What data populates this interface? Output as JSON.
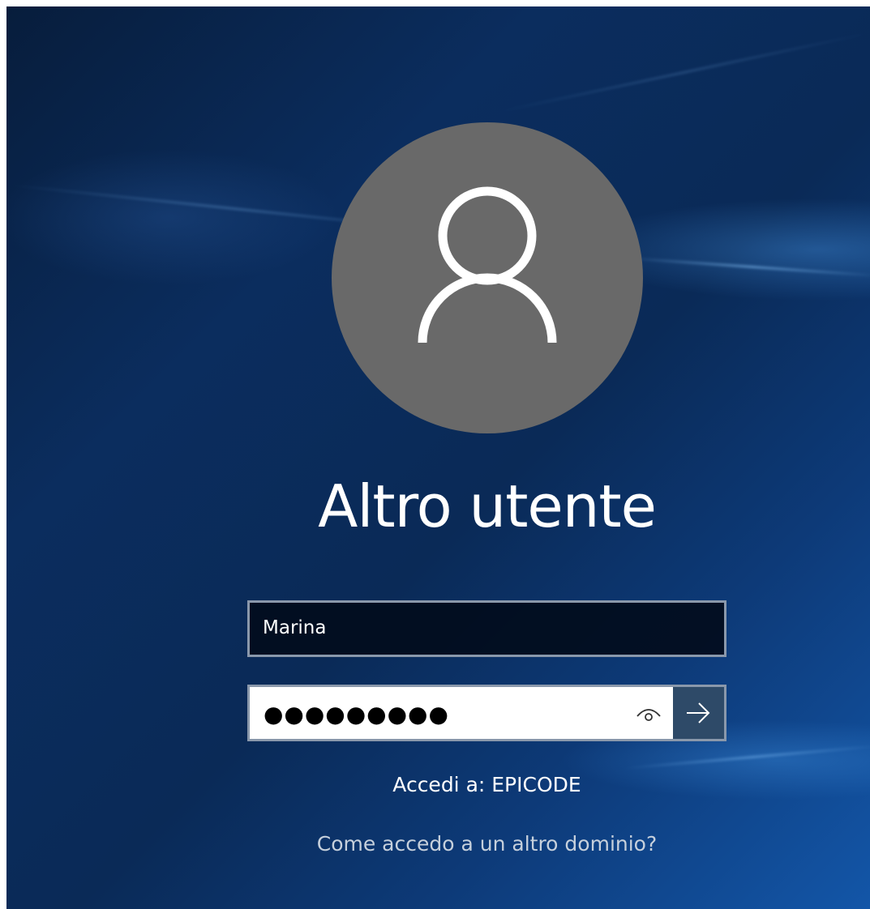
{
  "login": {
    "user_display_name": "Altro utente",
    "username_value": "Marina",
    "password_masked": "●●●●●●●●●",
    "reveal_icon": "eye-icon",
    "submit_icon": "arrow-right-icon",
    "domain_text": "Accedi a: EPICODE",
    "other_domain_link": "Come accedo a un altro dominio?"
  },
  "colors": {
    "background": "#0b2d5e",
    "avatar": "#696969",
    "field_border": "#8a98ab",
    "submit_button": "#2e4a68",
    "text": "#ffffff",
    "link_text": "#c6d0dc"
  }
}
